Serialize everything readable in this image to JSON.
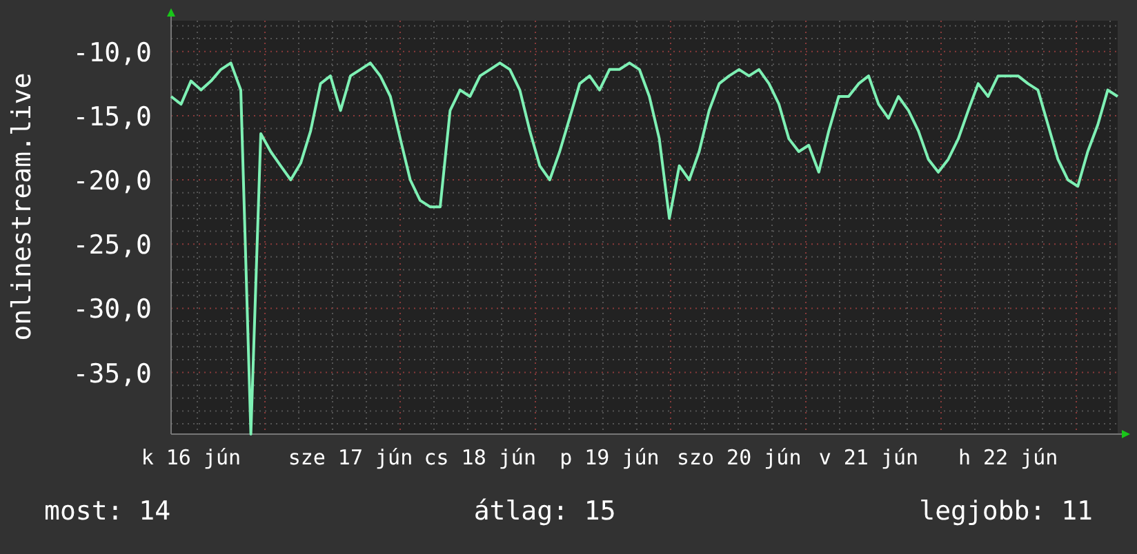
{
  "chart": {
    "chart_data": {
      "type": "line",
      "grid": true,
      "ylabel": "onlinestream.live",
      "ylim": [
        -39.8,
        -7.6
      ],
      "yticks": [
        {
          "value": -10,
          "label": "-10,0"
        },
        {
          "value": -15,
          "label": "-15,0"
        },
        {
          "value": -20,
          "label": "-20,0"
        },
        {
          "value": -25,
          "label": "-25,0"
        },
        {
          "value": -30,
          "label": "-30,0"
        },
        {
          "value": -35,
          "label": "-35,0"
        }
      ],
      "categories": [
        null,
        null,
        "k 16 jún",
        null,
        null,
        null,
        null,
        null,
        null,
        null,
        null,
        null,
        null,
        null,
        null,
        null,
        null,
        null,
        "sze 17 jún",
        null,
        null,
        null,
        null,
        null,
        null,
        null,
        null,
        null,
        null,
        null,
        null,
        "cs 18 jún",
        null,
        null,
        null,
        null,
        null,
        null,
        null,
        null,
        null,
        null,
        null,
        null,
        "p 19 jún",
        null,
        null,
        null,
        null,
        null,
        null,
        null,
        null,
        null,
        null,
        null,
        null,
        "szo 20 jún",
        null,
        null,
        null,
        null,
        null,
        null,
        null,
        null,
        null,
        null,
        null,
        null,
        "v 21 jún",
        null,
        null,
        null,
        null,
        null,
        null,
        null,
        null,
        null,
        null,
        null,
        null,
        null,
        "h 22 jún",
        null,
        null,
        null,
        null,
        null,
        null,
        null,
        null,
        null,
        null,
        null
      ],
      "series": [
        {
          "color": "#7ef0b4",
          "values": [
            -13.5,
            -14.1,
            -12.3,
            -13.0,
            -12.3,
            -11.4,
            -10.9,
            -13.0,
            -39.8,
            -16.4,
            -17.8,
            -18.9,
            -20.0,
            -18.7,
            -16.2,
            -12.5,
            -11.9,
            -14.6,
            -11.9,
            -11.4,
            -10.9,
            -11.9,
            -13.5,
            -16.8,
            -20.0,
            -21.6,
            -22.1,
            -22.1,
            -14.6,
            -13.0,
            -13.5,
            -11.9,
            -11.4,
            -10.9,
            -11.4,
            -13.0,
            -16.2,
            -18.9,
            -20.0,
            -17.8,
            -15.2,
            -12.5,
            -11.9,
            -13.0,
            -11.4,
            -11.4,
            -10.9,
            -11.4,
            -13.5,
            -16.8,
            -23.0,
            -18.9,
            -20.0,
            -17.8,
            -14.6,
            -12.5,
            -11.9,
            -11.4,
            -11.9,
            -11.4,
            -12.5,
            -14.1,
            -16.8,
            -17.8,
            -17.3,
            -19.4,
            -16.2,
            -13.5,
            -13.5,
            -12.5,
            -11.9,
            -14.1,
            -15.2,
            -13.5,
            -14.6,
            -16.2,
            -18.4,
            -19.4,
            -18.4,
            -16.8,
            -14.6,
            -12.5,
            -13.5,
            -11.9,
            -11.9,
            -11.9,
            -12.5,
            -13.0,
            -15.7,
            -18.4,
            -20.0,
            -20.5,
            -17.8,
            -15.7,
            -13.0,
            -13.5
          ]
        }
      ]
    }
  },
  "legend": [
    {
      "label": "most: 14"
    },
    {
      "label": "átlag: 15"
    },
    {
      "label": "legjobb: 11"
    }
  ]
}
